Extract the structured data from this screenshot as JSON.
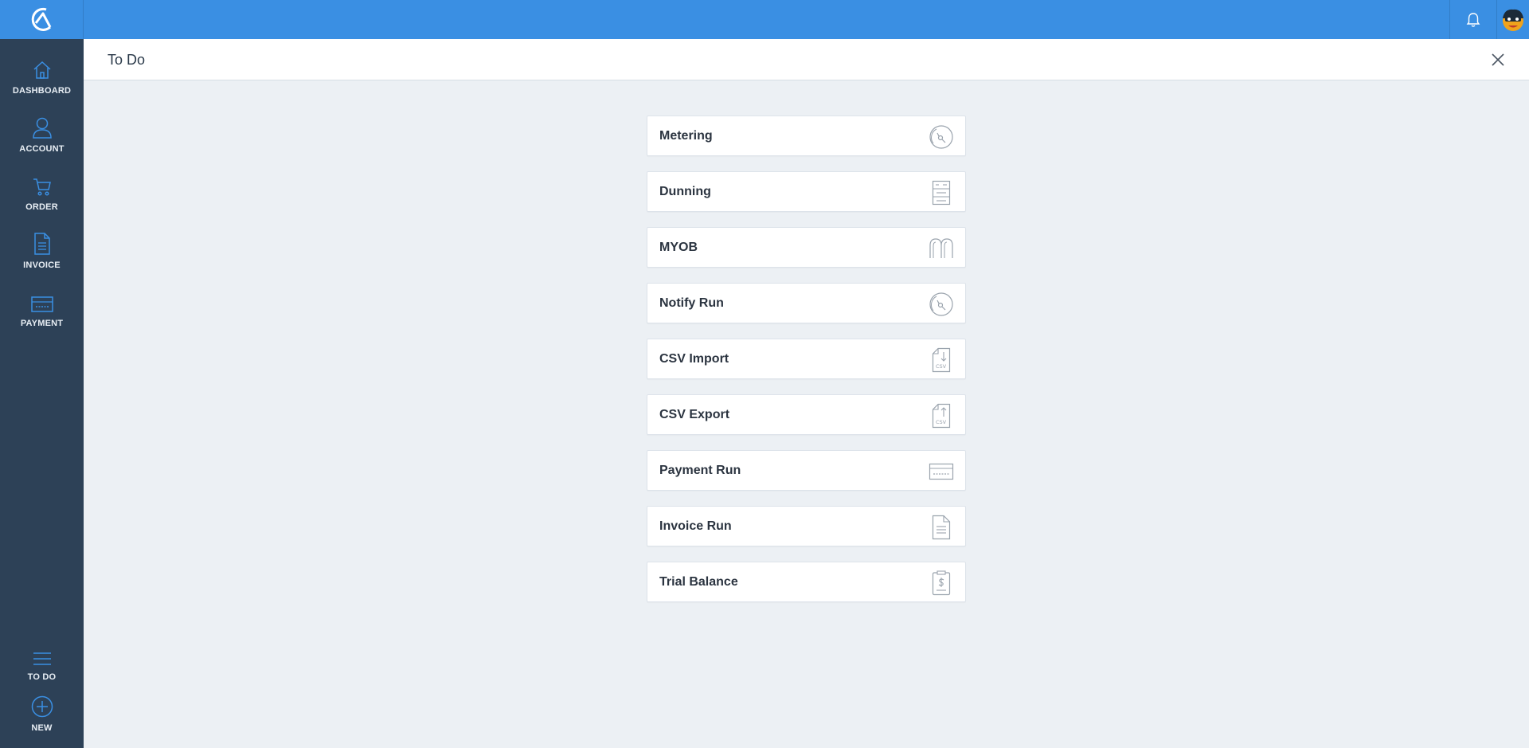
{
  "app": {
    "logo": "company-logo"
  },
  "topbar": {
    "icons": [
      "bell-icon",
      "avatar"
    ]
  },
  "sidebar": {
    "items": [
      {
        "label": "DASHBOARD",
        "icon": "home-icon"
      },
      {
        "label": "ACCOUNT",
        "icon": "user-icon"
      },
      {
        "label": "ORDER",
        "icon": "cart-icon"
      },
      {
        "label": "INVOICE",
        "icon": "document-icon"
      },
      {
        "label": "PAYMENT",
        "icon": "credit-card-icon"
      }
    ],
    "bottom_items": [
      {
        "label": "TO DO",
        "icon": "menu-lines-icon"
      },
      {
        "label": "NEW",
        "icon": "plus-circle-icon"
      }
    ]
  },
  "page": {
    "title": "To Do"
  },
  "todo_items": [
    {
      "label": "Metering",
      "icon": "gauge-icon"
    },
    {
      "label": "Dunning",
      "icon": "filing-cabinet-icon"
    },
    {
      "label": "MYOB",
      "icon": "myob-logo-icon"
    },
    {
      "label": "Notify Run",
      "icon": "gauge-icon"
    },
    {
      "label": "CSV Import",
      "icon": "csv-import-icon"
    },
    {
      "label": "CSV Export",
      "icon": "csv-export-icon"
    },
    {
      "label": "Payment Run",
      "icon": "credit-card-icon"
    },
    {
      "label": "Invoice Run",
      "icon": "document-icon"
    },
    {
      "label": "Trial Balance",
      "icon": "dollar-document-icon"
    }
  ],
  "colors": {
    "topbar": "#3a8fe3",
    "sidebar": "#2d4157",
    "sidebar_icon": "#3a8fe3",
    "background": "#ecf0f4"
  }
}
